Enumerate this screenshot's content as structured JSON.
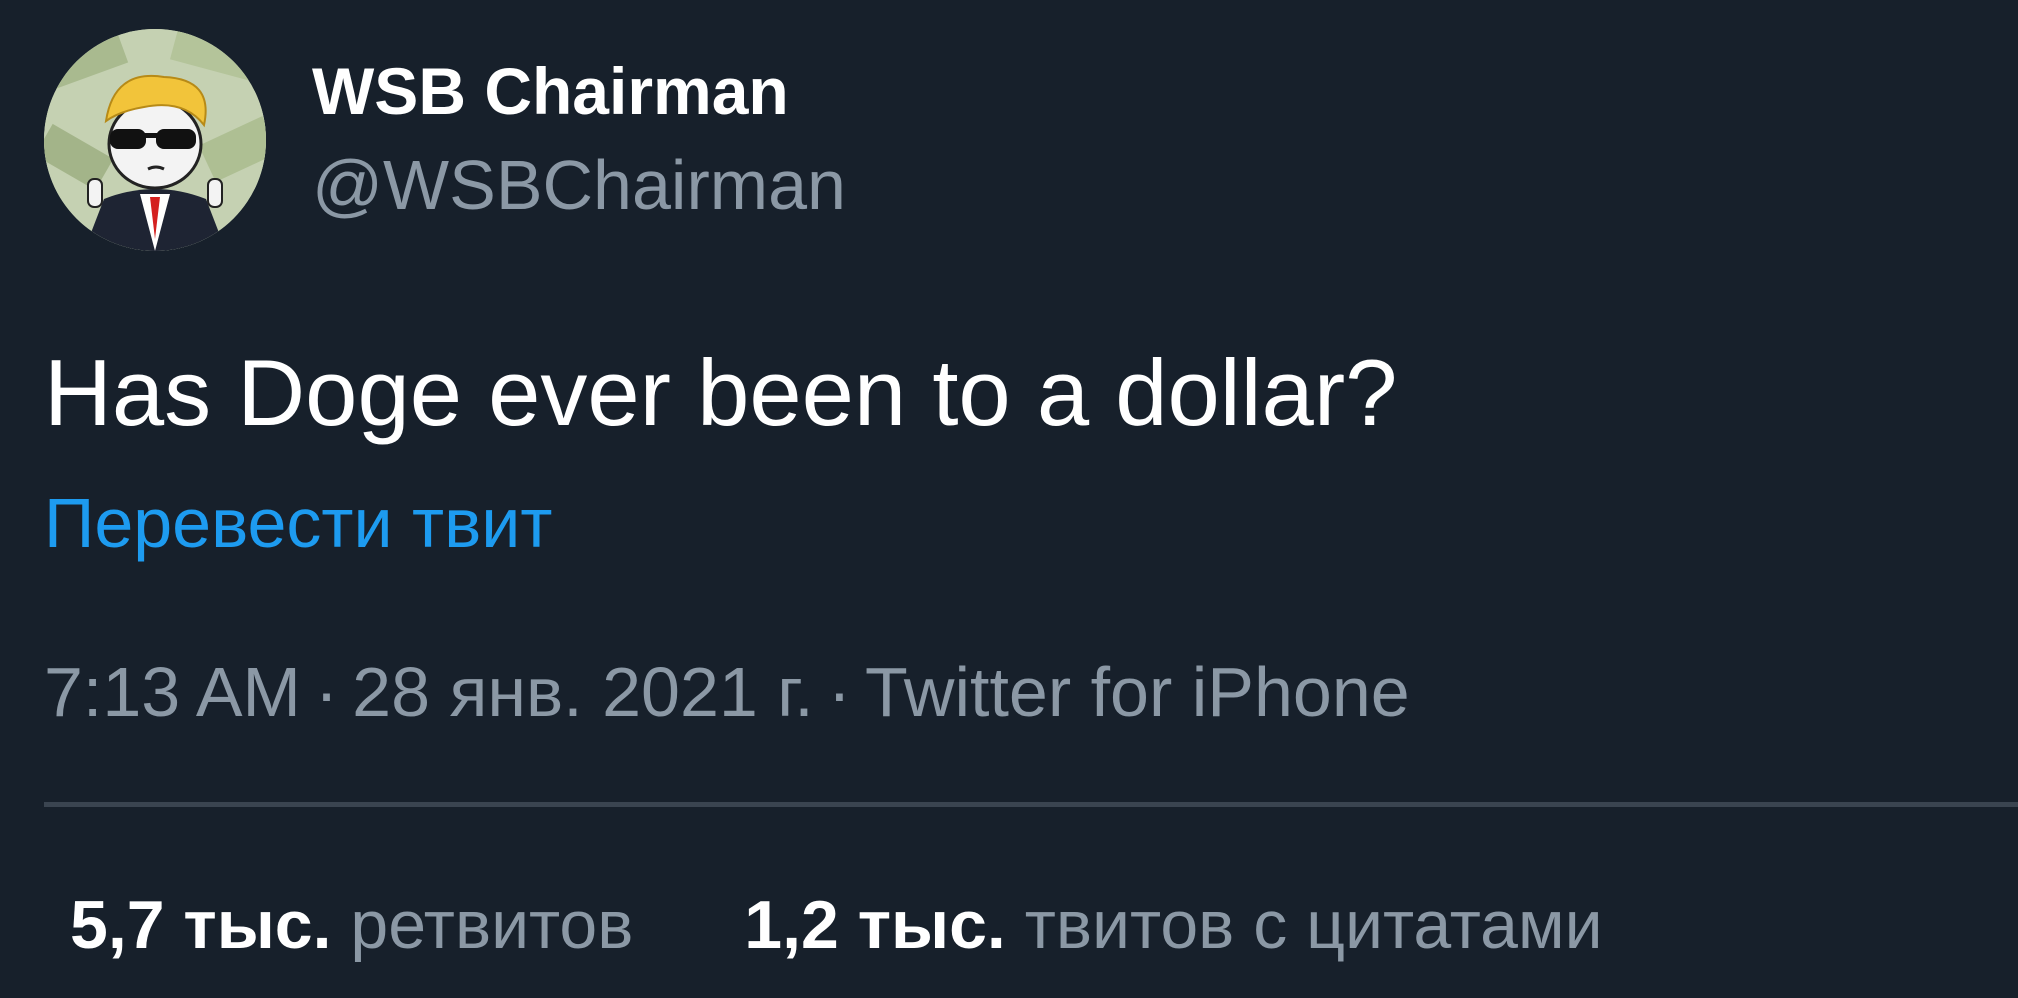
{
  "author": {
    "display_name": "WSB Chairman",
    "handle": "@WSBChairman"
  },
  "tweet": {
    "text": "Has Doge ever been to a dollar?",
    "translate_label": "Перевести твит"
  },
  "meta": {
    "time": "7:13 AM",
    "date": "28 янв. 2021 г.",
    "source": "Twitter for iPhone",
    "separator": "·"
  },
  "stats": [
    {
      "count": "5,7 тыс.",
      "label": "ретвитов"
    },
    {
      "count": "1,2 тыс.",
      "label": "твитов с цитатами"
    }
  ],
  "colors": {
    "background": "#17202b",
    "link": "#1d9bf0",
    "secondary_text": "#8b98a5"
  }
}
